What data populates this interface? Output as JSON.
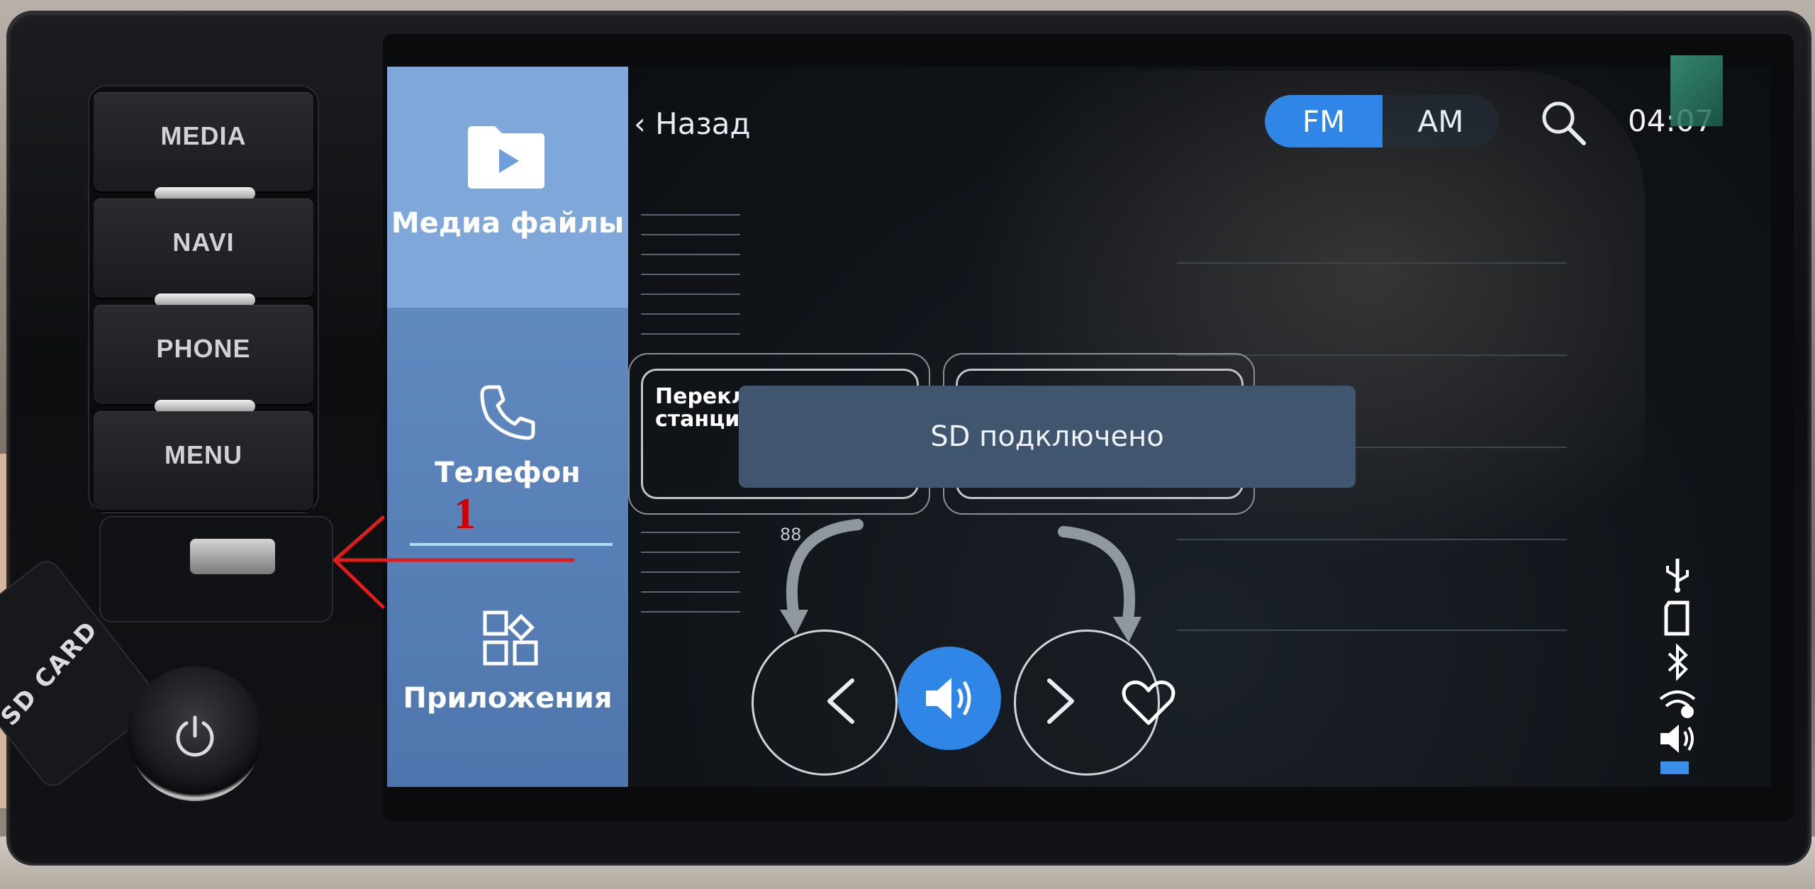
{
  "hardware": {
    "buttons": [
      "MEDIA",
      "NAVI",
      "PHONE",
      "MENU"
    ],
    "sd_card_label": "SD CARD"
  },
  "sidebar": {
    "items": [
      {
        "label": "Медиа файлы",
        "icon": "media-folder-icon",
        "active": true
      },
      {
        "label": "Телефон",
        "icon": "phone-icon",
        "active": false
      },
      {
        "label": "Приложения",
        "icon": "apps-icon",
        "active": false
      }
    ]
  },
  "header": {
    "back_label": "Назад",
    "bands": [
      "FM",
      "AM"
    ],
    "active_band": "FM",
    "clock": "04:07"
  },
  "main": {
    "station_text": "Перекл предыд станци нажати",
    "toast": "SD подключено",
    "freq_hint": "88"
  },
  "annotation": {
    "number": "1"
  },
  "colors": {
    "accent": "#2f86e6",
    "sidebar": "#5b84bd",
    "sidebar_active": "#7fa7da",
    "toast": "#40566e",
    "annotation": "#e21b1b"
  }
}
